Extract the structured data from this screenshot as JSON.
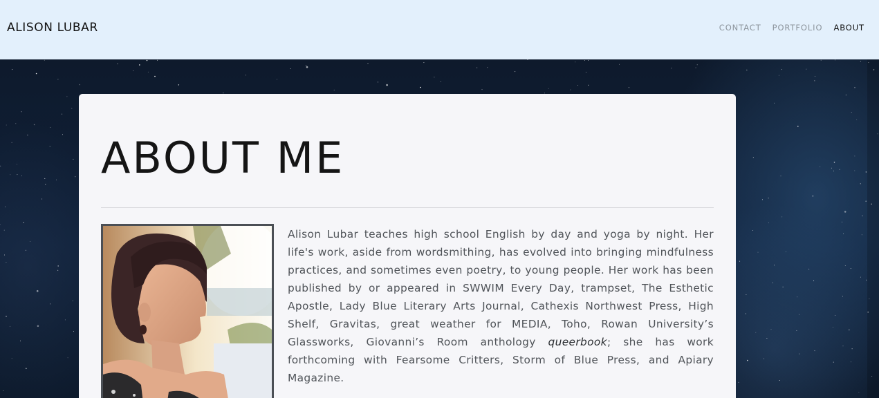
{
  "navbar": {
    "brand": "ALISON LUBAR",
    "links": [
      {
        "label": "CONTACT",
        "active": false
      },
      {
        "label": "PORTFOLIO",
        "active": false
      },
      {
        "label": "ABOUT",
        "active": true
      }
    ]
  },
  "about": {
    "title": "ABOUT ME",
    "bio_before_italic": "Alison Lubar teaches high school English by day and yoga by night. Her life's work, aside from wordsmithing, has evolved into bringing mindfulness practices, and sometimes even poetry, to young people. Her work has been published by or appeared in SWWIM Every Day, trampset, The Esthetic Apostle, Lady Blue Literary Arts Journal, Cathexis Northwest Press, High Shelf, Gravitas, great weather for MEDIA, Toho, Rowan University’s Glassworks, Giovanni’s Room anthology ",
    "bio_italic": "queerbook",
    "bio_after_italic": "; she has work forthcoming with Fearsome Critters, Storm of Blue Press, and Apiary Magazine.",
    "portrait_icon": "portrait-photo"
  },
  "colors": {
    "navbar_bg": "#e3f0fc",
    "card_bg": "#f6f6f9",
    "text_dark": "#151515",
    "text_body": "#505459",
    "nav_inactive": "#8c949c"
  }
}
